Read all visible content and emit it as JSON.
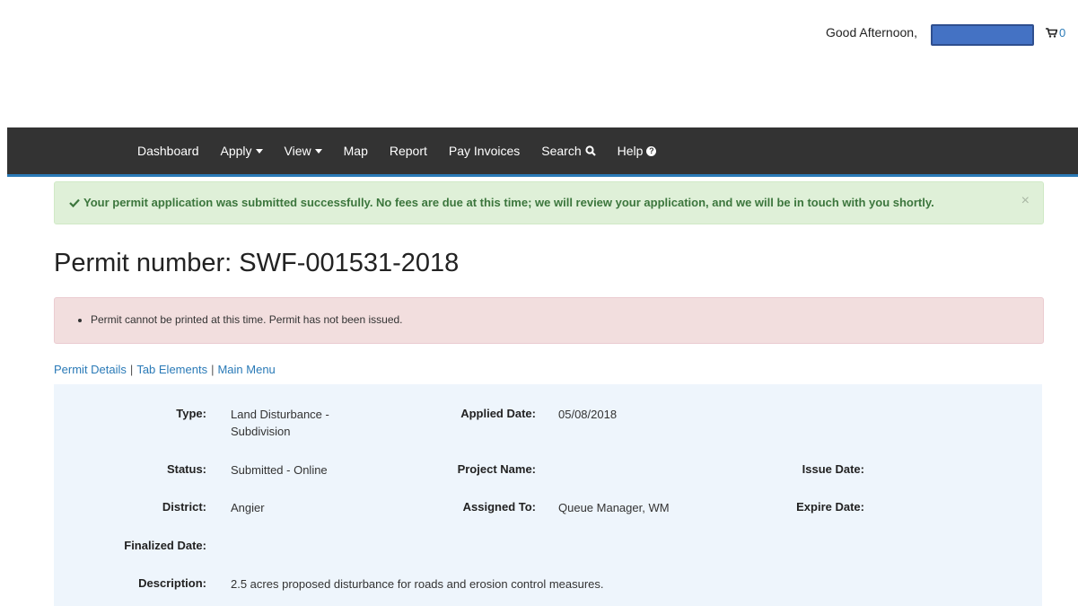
{
  "header": {
    "greeting": "Good Afternoon,",
    "cart_count": "0",
    "cart_icon": "cart-icon"
  },
  "nav": {
    "items": [
      {
        "label": "Dashboard",
        "dropdown": false
      },
      {
        "label": "Apply",
        "dropdown": true
      },
      {
        "label": "View",
        "dropdown": true
      },
      {
        "label": "Map",
        "dropdown": false
      },
      {
        "label": "Report",
        "dropdown": false
      },
      {
        "label": "Pay Invoices",
        "dropdown": false
      },
      {
        "label": "Search",
        "icon": "search-icon"
      },
      {
        "label": "Help",
        "icon": "help-icon"
      }
    ]
  },
  "alerts": {
    "success": "Your permit application was submitted successfully. No fees are due at this time; we will review your application, and we will be in touch with you shortly.",
    "success_close": "×",
    "error": "Permit cannot be printed at this time. Permit has not been issued."
  },
  "permit": {
    "title": "Permit number: SWF-001531-2018"
  },
  "links": [
    "Permit Details",
    "Tab Elements",
    "Main Menu"
  ],
  "details": {
    "type_label": "Type:",
    "type_value": "Land Disturbance - Subdivision",
    "applied_label": "Applied Date:",
    "applied_value": "05/08/2018",
    "status_label": "Status:",
    "status_value": "Submitted - Online",
    "project_label": "Project Name:",
    "project_value": "",
    "issue_label": "Issue Date:",
    "issue_value": "",
    "district_label": "District:",
    "district_value": "Angier",
    "assigned_label": "Assigned To:",
    "assigned_value": "Queue Manager, WM",
    "expire_label": "Expire Date:",
    "expire_value": "",
    "finalized_label": "Finalized Date:",
    "finalized_value": "",
    "description_label": "Description:",
    "description_value": "2.5 acres proposed disturbance for roads and erosion control measures."
  },
  "colors": {
    "navbar": "#333333",
    "accent": "#2a7ab7",
    "success_bg": "#dff0d8",
    "success_text": "#3c763d",
    "danger_bg": "#f2dede",
    "details_bg": "#eef5fc"
  }
}
